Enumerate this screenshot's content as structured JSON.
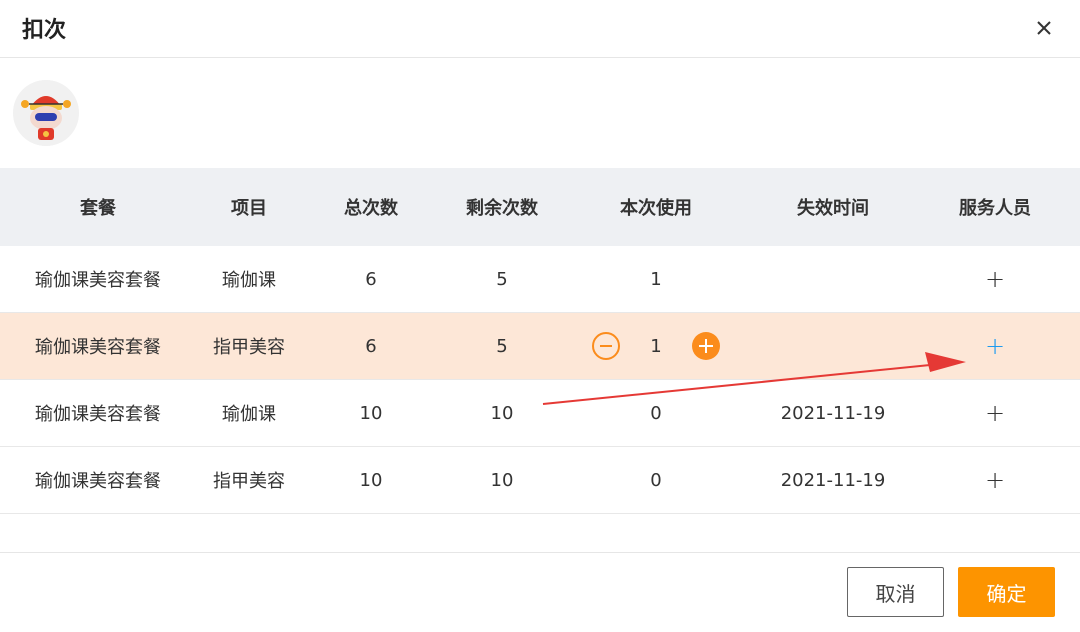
{
  "dialog": {
    "title": "扣次"
  },
  "table": {
    "headers": [
      "套餐",
      "项目",
      "总次数",
      "剩余次数",
      "本次使用",
      "失效时间",
      "服务人员"
    ],
    "rows": [
      {
        "package": "瑜伽课美容套餐",
        "item": "瑜伽课",
        "total": "6",
        "remaining": "5",
        "use": "1",
        "expire": ""
      },
      {
        "package": "瑜伽课美容套餐",
        "item": "指甲美容",
        "total": "6",
        "remaining": "5",
        "use": "1",
        "expire": ""
      },
      {
        "package": "瑜伽课美容套餐",
        "item": "瑜伽课",
        "total": "10",
        "remaining": "10",
        "use": "0",
        "expire": "2021-11-19"
      },
      {
        "package": "瑜伽课美容套餐",
        "item": "指甲美容",
        "total": "10",
        "remaining": "10",
        "use": "0",
        "expire": "2021-11-19"
      }
    ],
    "add_staff_symbol": "+"
  },
  "footer": {
    "cancel_label": "取消",
    "confirm_label": "确定"
  },
  "colors": {
    "accent": "#fd9400",
    "highlight_row": "#fde7d7",
    "link_blue": "#1e9bf0",
    "annotation_arrow": "#e53935"
  },
  "icons": [
    "close-icon",
    "avatar-image",
    "minus-circle-icon",
    "plus-circle-icon",
    "plus-icon",
    "annotation-arrow"
  ]
}
